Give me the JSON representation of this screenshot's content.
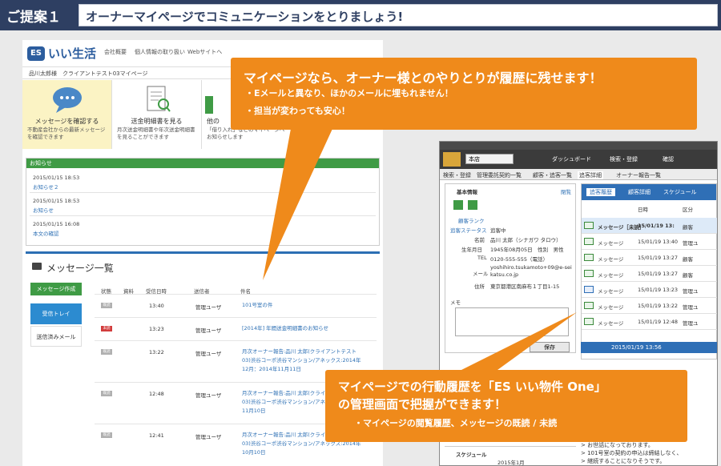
{
  "header": {
    "tag": "ご提案１",
    "title": "オーナーマイページでコミュニケーションをとりましょう!"
  },
  "mypage": {
    "logo": "ES",
    "site_name": "いい生活",
    "nav": [
      "会社概要",
      "個人情報の取り扱い",
      "Webサイトへ"
    ],
    "owner_line": "品川太郎様　クライアントテスト03マイページ",
    "tiles": [
      {
        "title": "メッセージを確認する",
        "desc": "不動産会社からの最新メッセージを確認できます"
      },
      {
        "title": "送金明細書を見る",
        "desc": "月次送金明細書や年次送金明細書を見ることができます"
      },
      {
        "title": "他の",
        "desc": "「借り入れ」などのマイページへお知らせします"
      }
    ],
    "notices": {
      "heading": "お知らせ",
      "items": [
        {
          "date": "2015/01/15 18:53",
          "title": "お知らせ２"
        },
        {
          "date": "2015/01/15 18:53",
          "title": "お知らせ"
        },
        {
          "date": "2015/01/15 16:08",
          "title": "本文の確認"
        }
      ]
    },
    "messages": {
      "title": "メッセージ一覧",
      "side": [
        "メッセージ作成",
        "受信トレイ",
        "送信済みメール"
      ],
      "columns": [
        "状態",
        "資料",
        "受信日時",
        "送信者",
        "件名"
      ],
      "rows": [
        {
          "status": "既読",
          "unread": false,
          "time": "13:40",
          "sender": "管理ユーザ",
          "subject": "101号室の件"
        },
        {
          "status": "未読",
          "unread": true,
          "time": "13:23",
          "sender": "管理ユーザ",
          "subject": "[2014年] 年間送金明細書のお知らせ"
        },
        {
          "status": "既読",
          "unread": false,
          "time": "13:22",
          "sender": "管理ユーザ",
          "subject": "月次オーナー報告:品川 太郎(クライアントテスト03)渋谷コーポ渋谷マンション/アネックス:2014年12月：2014年11月11日"
        },
        {
          "status": "既読",
          "unread": false,
          "time": "12:48",
          "sender": "管理ユーザ",
          "subject": "月次オーナー報告:品川 太郎(クライアントテスト03)渋谷コーポ渋谷マンション/アネックス:2014年11月10日"
        },
        {
          "status": "既読",
          "unread": false,
          "time": "12:41",
          "sender": "管理ユーザ",
          "subject": "月次オーナー報告:品川 太郎(クライアントテスト03)渋谷コーポ渋谷マンション/アネックス:2014年10月10日"
        }
      ]
    }
  },
  "app": {
    "store": "本店",
    "menu": [
      "ダッシュボード",
      "検索・登録",
      "確認"
    ],
    "tabs": [
      "検索・登録",
      "管理委託契約一覧",
      "顧客・追客一覧",
      "追客詳細",
      "オーナー報告一覧"
    ],
    "basic": {
      "heading": "基本情報",
      "link_close": "閉覧",
      "rank_label": "顧客ランク",
      "status_label": "追客ステータス",
      "status_value": "追客中",
      "name_label": "名前",
      "name_value": "品川 太郎（シナガワ タロウ）",
      "birth_label": "生年月日",
      "birth_value": "1945年08月05日　性別　男性",
      "tel_label": "TEL",
      "tel_value": "0120-555-555（電話）",
      "mail_label": "メール",
      "mail_value": "yoshihiro.tsukamoto+09@e-seikatsu.co.jp",
      "addr_label": "住所",
      "addr_value": "東京都港区南麻布１丁目1-15",
      "memo_label": "メモ",
      "save": "保存",
      "schedule": "スケジュール",
      "calendar": "2015年1月"
    },
    "history": {
      "tabs": [
        "追客履歴",
        "顧客詳細",
        "スケジュール"
      ],
      "col_date": "日時",
      "col_type": "区分",
      "rows": [
        {
          "type": "メッセージ［未読］",
          "date": "15/01/19 13:",
          "who": "顧客",
          "hl": true
        },
        {
          "type": "メッセージ",
          "date": "15/01/19 13:40",
          "who": "管理ユ",
          "hl": false
        },
        {
          "type": "メッセージ",
          "date": "15/01/19 13:27",
          "who": "顧客",
          "hl": false
        },
        {
          "type": "メッセージ",
          "date": "15/01/19 13:27",
          "who": "顧客",
          "hl": false
        },
        {
          "type": "メッセージ",
          "date": "15/01/19 13:23",
          "who": "管理ユ",
          "hl": false
        },
        {
          "type": "メッセージ",
          "date": "15/01/19 13:22",
          "who": "管理ユ",
          "hl": false
        },
        {
          "type": "メッセージ",
          "date": "15/01/19 12:48",
          "who": "管理ユ",
          "hl": false
        }
      ],
      "status_text": "2015/01/19 13:56",
      "bottom_lines": [
        "> お世話になっております。",
        "> 101号室の契約の申込は締結しなく、",
        "> 継続することになりそうです。"
      ]
    }
  },
  "callouts": {
    "top": {
      "title": "マイページなら、オーナー様とのやりとりが履歴に残せます！",
      "bullets": [
        "・Eメールと異なり、ほかのメールに埋もれません！",
        "・担当が変わっても安心！"
      ]
    },
    "bottom": {
      "title_line1": "マイページでの行動履歴を「ES いい物件 One」",
      "title_line2": "の管理画面で把握ができます！",
      "bullet": "・マイページの閲覧履歴、メッセージの既読 / 未読"
    }
  },
  "colors": {
    "header_bg": "#2e3f62",
    "callout": "#ef8a1b",
    "green": "#3f9b45",
    "blue": "#2c6fb4"
  }
}
